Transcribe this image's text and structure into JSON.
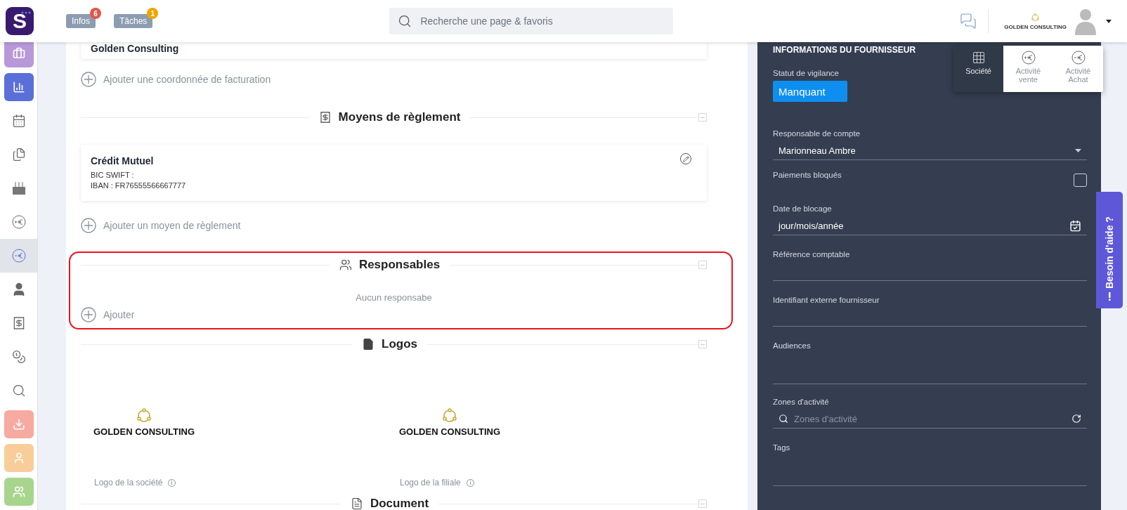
{
  "header": {
    "logo_text": "S",
    "buttons": [
      {
        "label": "Infos",
        "badge": "6",
        "color": "#e2574c"
      },
      {
        "label": "Tâches",
        "badge": "1",
        "color": "#f0a500"
      }
    ],
    "search": {
      "placeholder": "Recherche une page & favoris"
    },
    "company": "GOLDEN CONSULTING"
  },
  "sidebar": {
    "items": [
      {
        "kind": "tile",
        "color": "#b898d8",
        "selected": false
      },
      {
        "kind": "tile",
        "color": "#5a6fd8",
        "selected": false
      },
      {
        "kind": "plain",
        "selected": false
      },
      {
        "kind": "plain",
        "selected": false
      },
      {
        "kind": "plain",
        "selected": false
      },
      {
        "kind": "plain",
        "selected": false
      },
      {
        "kind": "plain",
        "selected": true
      },
      {
        "kind": "plain",
        "selected": false
      },
      {
        "kind": "plain",
        "selected": false
      },
      {
        "kind": "plain",
        "selected": false
      },
      {
        "kind": "plain",
        "selected": false
      },
      {
        "kind": "tile",
        "color": "#f7aaa0",
        "selected": false
      },
      {
        "kind": "tile",
        "color": "#f9cd9a",
        "selected": false
      },
      {
        "kind": "tile",
        "color": "#a8d58e",
        "selected": false
      }
    ]
  },
  "billing": {
    "card_title": "Golden Consulting",
    "add_label": "Ajouter une coordonnée de facturation"
  },
  "sections": [
    {
      "kind": "payment",
      "title": "Moyens de règlement",
      "highlighted": false,
      "cards": [
        {
          "title": "Crédit Mutuel",
          "lines": [
            "BIC SWIFT :",
            "IBAN : FR76555566667777"
          ]
        }
      ],
      "add_label": "Ajouter un moyen de règlement"
    },
    {
      "kind": "people",
      "title": "Responsables",
      "highlighted": true,
      "empty_text": "Aucun responsabe",
      "add_label": "Ajouter"
    },
    {
      "kind": "logos",
      "title": "Logos",
      "highlighted": false,
      "logos": [
        {
          "name": "GOLDEN CONSULTING",
          "caption": "Logo de la société"
        },
        {
          "name": "GOLDEN CONSULTING",
          "caption": "Logo de la filiale"
        }
      ]
    },
    {
      "kind": "document",
      "title": "Document",
      "highlighted": false
    }
  ],
  "supplier_panel": {
    "title": "INFORMATIONS DU FOURNISSEUR",
    "vigilance": {
      "label": "Statut de vigilance",
      "value": "Manquant"
    },
    "fields": [
      {
        "kind": "select",
        "label": "Responsable de compte",
        "value": "Marionneau Ambre"
      },
      {
        "kind": "checkbox",
        "label": "Paiements bloqués",
        "checked": false
      },
      {
        "kind": "date",
        "label": "Date de blocage",
        "placeholder": "jour/mois/année"
      },
      {
        "kind": "text",
        "label": "Référence comptable"
      },
      {
        "kind": "text",
        "label": "Identifiant externe fournisseur"
      },
      {
        "kind": "area",
        "label": "Audiences"
      },
      {
        "kind": "search",
        "label": "Zones d'activité",
        "placeholder": "Zones d'activité"
      },
      {
        "kind": "area",
        "label": "Tags"
      }
    ]
  },
  "view_switcher": [
    {
      "kind": "company",
      "label": "Société",
      "selected": true
    },
    {
      "kind": "sale",
      "label": "Activité vente",
      "selected": false
    },
    {
      "kind": "purchase",
      "label": "Activité Achat",
      "selected": false
    }
  ],
  "help_tab": {
    "label": "Besoin d'aide ?"
  }
}
